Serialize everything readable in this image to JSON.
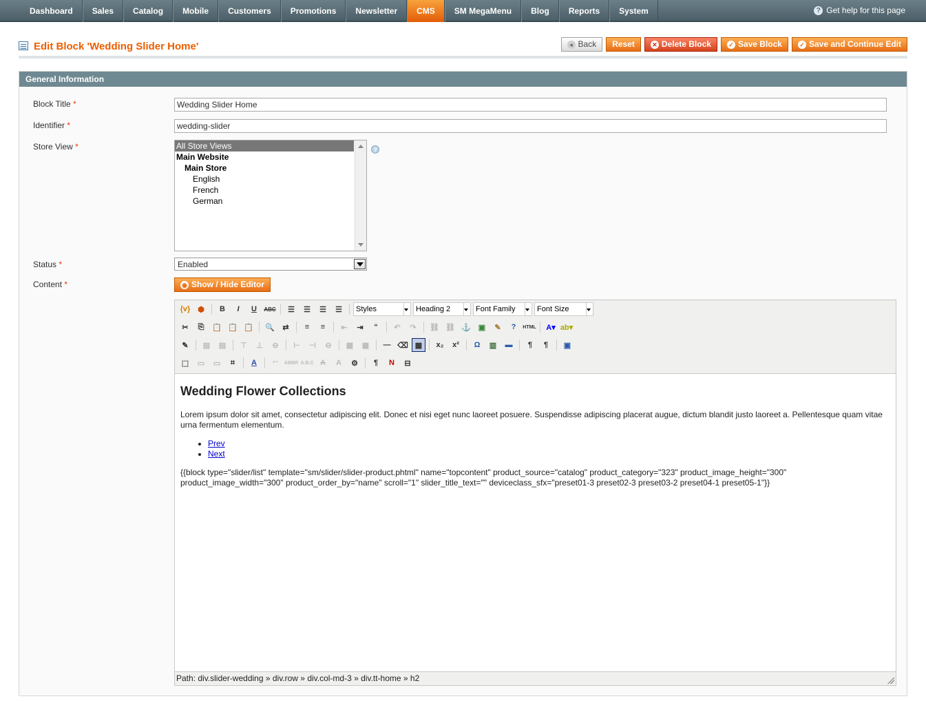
{
  "nav": {
    "items": [
      "Dashboard",
      "Sales",
      "Catalog",
      "Mobile",
      "Customers",
      "Promotions",
      "Newsletter",
      "CMS",
      "SM MegaMenu",
      "Blog",
      "Reports",
      "System"
    ],
    "active": "CMS",
    "help": "Get help for this page"
  },
  "header": {
    "title": "Edit Block 'Wedding Slider Home'",
    "buttons": {
      "back": "Back",
      "reset": "Reset",
      "delete": "Delete Block",
      "save": "Save Block",
      "save_continue": "Save and Continue Edit"
    }
  },
  "section": {
    "title": "General Information",
    "labels": {
      "block_title": "Block Title",
      "identifier": "Identifier",
      "store_view": "Store View",
      "status": "Status",
      "content": "Content"
    },
    "required_mark": "*",
    "block_title_value": "Wedding Slider Home",
    "identifier_value": "wedding-slider",
    "store_options": [
      "All Store Views",
      "Main Website",
      "Main Store",
      "English",
      "French",
      "German"
    ],
    "status_value": "Enabled",
    "toggle_editor": "Show / Hide Editor"
  },
  "editor": {
    "dropdowns": {
      "styles": "Styles",
      "format": "Heading 2",
      "font_family": "Font Family",
      "font_size": "Font Size"
    },
    "content": {
      "heading": "Wedding Flower Collections",
      "paragraph": "Lorem ipsum dolor sit amet, consectetur adipiscing elit. Donec et nisi eget nunc laoreet posuere. Suspendisse adipiscing placerat augue, dictum blandit justo laoreet a. Pellentesque quam vitae urna fermentum elementum.",
      "links": [
        "Prev",
        "Next"
      ],
      "code": "{{block type=\"slider/list\" template=\"sm/slider/slider-product.phtml\" name=\"topcontent\" product_source=\"catalog\" product_category=\"323\" product_image_height=\"300\" product_image_width=\"300\" product_order_by=\"name\" scroll=\"1\" slider_title_text=\"\" deviceclass_sfx=\"preset01-3 preset02-3 preset03-2 preset04-1 preset05-1\"}}"
    },
    "path": "Path: div.slider-wedding » div.row » div.col-md-3 » div.tt-home » h2"
  }
}
